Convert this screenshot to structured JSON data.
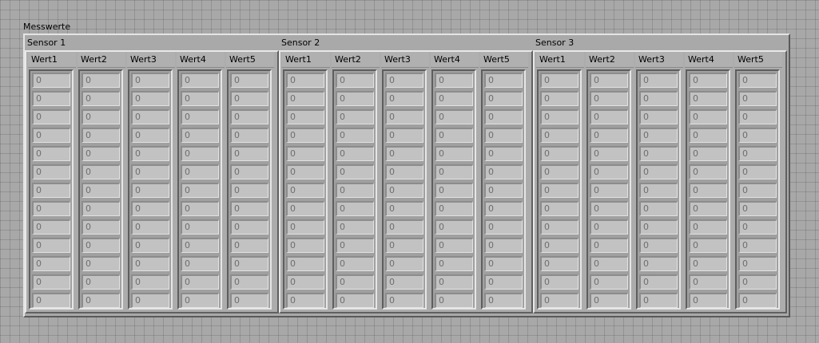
{
  "cluster": {
    "label": "Messwerte"
  },
  "sensors": [
    {
      "title": "Sensor 1",
      "columns": [
        {
          "label": "Wert1",
          "values": [
            "0",
            "0",
            "0",
            "0",
            "0",
            "0",
            "0",
            "0",
            "0",
            "0",
            "0",
            "0",
            "0"
          ]
        },
        {
          "label": "Wert2",
          "values": [
            "0",
            "0",
            "0",
            "0",
            "0",
            "0",
            "0",
            "0",
            "0",
            "0",
            "0",
            "0",
            "0"
          ]
        },
        {
          "label": "Wert3",
          "values": [
            "0",
            "0",
            "0",
            "0",
            "0",
            "0",
            "0",
            "0",
            "0",
            "0",
            "0",
            "0",
            "0"
          ]
        },
        {
          "label": "Wert4",
          "values": [
            "0",
            "0",
            "0",
            "0",
            "0",
            "0",
            "0",
            "0",
            "0",
            "0",
            "0",
            "0",
            "0"
          ]
        },
        {
          "label": "Wert5",
          "values": [
            "0",
            "0",
            "0",
            "0",
            "0",
            "0",
            "0",
            "0",
            "0",
            "0",
            "0",
            "0",
            "0"
          ]
        }
      ]
    },
    {
      "title": "Sensor 2",
      "columns": [
        {
          "label": "Wert1",
          "values": [
            "0",
            "0",
            "0",
            "0",
            "0",
            "0",
            "0",
            "0",
            "0",
            "0",
            "0",
            "0",
            "0"
          ]
        },
        {
          "label": "Wert2",
          "values": [
            "0",
            "0",
            "0",
            "0",
            "0",
            "0",
            "0",
            "0",
            "0",
            "0",
            "0",
            "0",
            "0"
          ]
        },
        {
          "label": "Wert3",
          "values": [
            "0",
            "0",
            "0",
            "0",
            "0",
            "0",
            "0",
            "0",
            "0",
            "0",
            "0",
            "0",
            "0"
          ]
        },
        {
          "label": "Wert4",
          "values": [
            "0",
            "0",
            "0",
            "0",
            "0",
            "0",
            "0",
            "0",
            "0",
            "0",
            "0",
            "0",
            "0"
          ]
        },
        {
          "label": "Wert5",
          "values": [
            "0",
            "0",
            "0",
            "0",
            "0",
            "0",
            "0",
            "0",
            "0",
            "0",
            "0",
            "0",
            "0"
          ]
        }
      ]
    },
    {
      "title": "Sensor 3",
      "columns": [
        {
          "label": "Wert1",
          "values": [
            "0",
            "0",
            "0",
            "0",
            "0",
            "0",
            "0",
            "0",
            "0",
            "0",
            "0",
            "0",
            "0"
          ]
        },
        {
          "label": "Wert2",
          "values": [
            "0",
            "0",
            "0",
            "0",
            "0",
            "0",
            "0",
            "0",
            "0",
            "0",
            "0",
            "0",
            "0"
          ]
        },
        {
          "label": "Wert3",
          "values": [
            "0",
            "0",
            "0",
            "0",
            "0",
            "0",
            "0",
            "0",
            "0",
            "0",
            "0",
            "0",
            "0"
          ]
        },
        {
          "label": "Wert4",
          "values": [
            "0",
            "0",
            "0",
            "0",
            "0",
            "0",
            "0",
            "0",
            "0",
            "0",
            "0",
            "0",
            "0"
          ]
        },
        {
          "label": "Wert5",
          "values": [
            "0",
            "0",
            "0",
            "0",
            "0",
            "0",
            "0",
            "0",
            "0",
            "0",
            "0",
            "0",
            "0"
          ]
        }
      ]
    }
  ]
}
